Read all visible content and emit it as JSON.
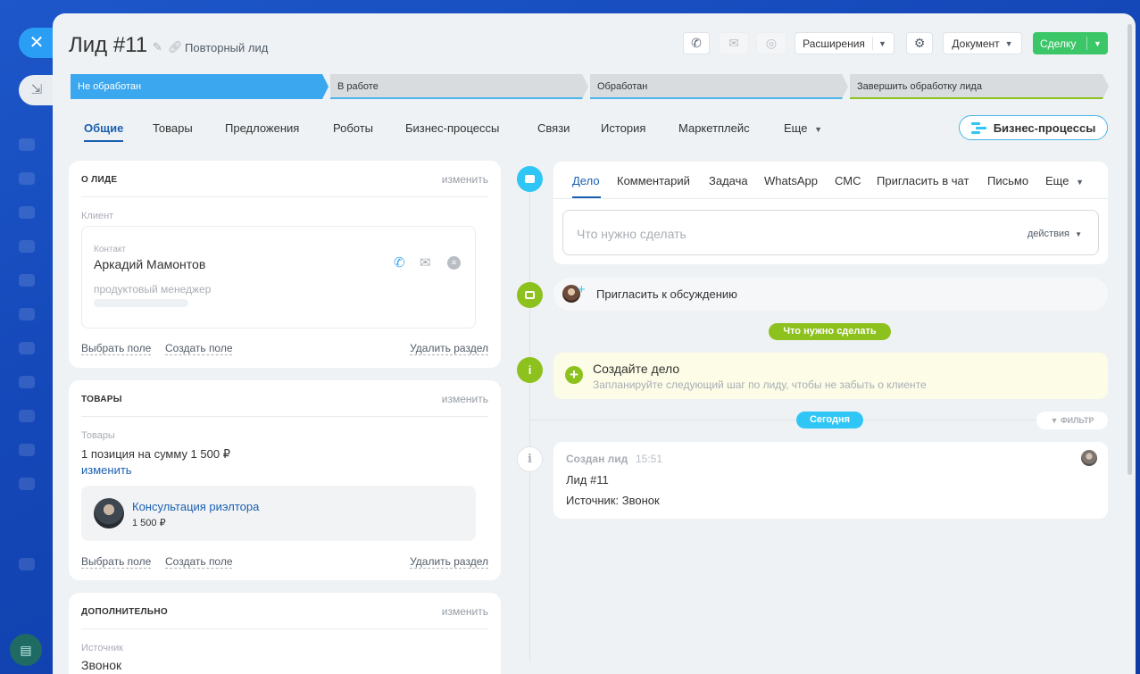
{
  "header": {
    "title": "Лид #11",
    "subtitle": "Повторный лид",
    "extensions_label": "Расширения",
    "document_label": "Документ",
    "deal_label": "Сделку"
  },
  "stages": [
    {
      "label": "Не обработан",
      "color": "#3ba7ee"
    },
    {
      "label": "В работе",
      "color": "#d8dcdf"
    },
    {
      "label": "Обработан",
      "color": "#d8dcdf"
    },
    {
      "label": "Завершить обработку лида",
      "color": "#d8dcdf"
    }
  ],
  "tabs": {
    "general": "Общие",
    "products": "Товары",
    "offers": "Предложения",
    "robots": "Роботы",
    "bizproc": "Бизнес-процессы",
    "links": "Связи",
    "history": "История",
    "marketplace": "Маркетплейс",
    "more": "Еще"
  },
  "bizproc_button": "Бизнес-процессы",
  "about": {
    "heading": "О ЛИДЕ",
    "edit": "изменить",
    "client_label": "Клиент",
    "contact_label": "Контакт",
    "contact_name": "Аркадий Мамонтов",
    "contact_position": "продуктовый менеджер",
    "select_field": "Выбрать поле",
    "create_field": "Создать поле",
    "delete_section": "Удалить раздел"
  },
  "products": {
    "heading": "ТОВАРЫ",
    "edit": "изменить",
    "label": "Товары",
    "summary": "1 позиция на сумму 1 500 ₽",
    "change": "изменить",
    "item_name": "Консультация риэлтора",
    "item_price": "1 500 ₽",
    "select_field": "Выбрать поле",
    "create_field": "Создать поле",
    "delete_section": "Удалить раздел"
  },
  "additional": {
    "heading": "ДОПОЛНИТЕЛЬНО",
    "edit": "изменить",
    "source_label": "Источник",
    "source_value": "Звонок"
  },
  "activity": {
    "tabs": [
      "Дело",
      "Комментарий",
      "Задача",
      "WhatsApp",
      "СМС",
      "Пригласить в чат",
      "Письмо",
      "Еще"
    ],
    "todo_placeholder": "Что нужно сделать",
    "actions_label": "действия"
  },
  "timeline": {
    "invite_label": "Пригласить к обсуждению",
    "todo_pill": "Что нужно сделать",
    "create_title": "Создайте дело",
    "create_hint": "Запланируйте следующий шаг по лиду, чтобы не забыть о клиенте",
    "today_pill": "Сегодня",
    "filter_label": "ФИЛЬТР",
    "event_title": "Создан лид",
    "event_time": "15:51",
    "event_line1": "Лид #11",
    "event_line2": "Источник: Звонок"
  },
  "colors": {
    "accent": "#1a60b3",
    "stage_active": "#3ba7ee",
    "green": "#3bc668",
    "lime": "#8dc11d",
    "sky": "#2fc6f6"
  }
}
